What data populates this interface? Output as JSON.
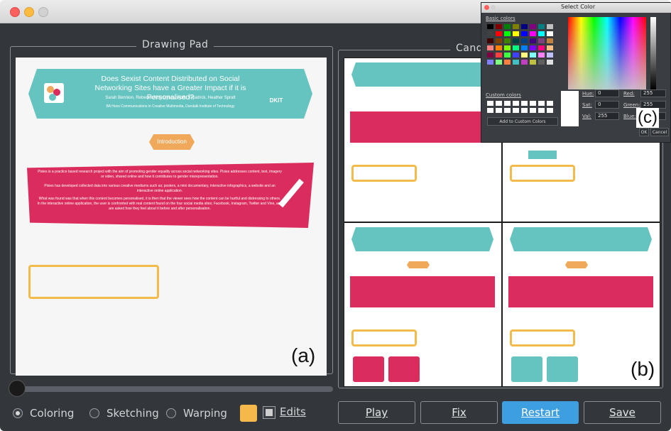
{
  "window": {
    "colors": {
      "accent": "#3d9ee0",
      "poster_teal": "#66c4c0",
      "poster_pink": "#db2d5d",
      "highlight_yellow": "#f5b84a"
    }
  },
  "drawing_pad": {
    "title": "Drawing Pad",
    "corner_label": "(a)",
    "poster": {
      "headline": "Does Sexist Content Distributed on Social Networking Sites have a Greater Impact if it is Personalised?",
      "authors": "Sarah Bennion, Rebecca Amy Dykes, Aoife Kilpatrick, Heather Spratt",
      "affiliation": "BA Hons Communications in Creative Multimedia, Dundalk Institute of Technology",
      "logo_text": "DKIT",
      "section_tag": "Introduction",
      "para1": "Pixies is a practice based research project with the aim of promoting gender equality across social networking sites. Pixies addresses content, text, imagery or video, shared online and how it contributes to gender misrepresentation.",
      "para2": "Pixies has developed collected data into various creative mediums such as; posters, a mini documentary, interactive infographics, a website and an interactive online application.",
      "para3": "What was found was that when this content becomes personalised, it is then that the viewer sees how the content can be hurtful and distressing to others. In the interactive online application, the user is confronted with real content found on the four social media sites; Facebook, Instagram, Twitter and Vine, and are asked how they feel about it before and after personalisation."
    }
  },
  "candidates": {
    "title": "Cand",
    "corner_label": "(b)"
  },
  "color_dialog": {
    "title": "Select Color",
    "basic_colors_label": "Basic colors",
    "custom_colors_label": "Custom colors",
    "add_custom_label": "Add to Custom Colors",
    "corner_label": "(c)",
    "fields": {
      "hue_label": "Hue:",
      "hue": "0",
      "sat_label": "Sat:",
      "sat": "0",
      "val_label": "Val:",
      "val": "255",
      "red_label": "Red:",
      "red": "255",
      "green_label": "Green:",
      "green": "255",
      "blue_label": "Blue:",
      "blue": "255"
    },
    "ok_label": "OK",
    "cancel_label": "Cancel"
  },
  "controls": {
    "mode_coloring": "Coloring",
    "mode_sketching": "Sketching",
    "mode_warping": "Warping",
    "edits_label": "Edits",
    "play_label": "Play",
    "fix_label": "Fix",
    "restart_label": "Restart",
    "save_label": "Save"
  }
}
